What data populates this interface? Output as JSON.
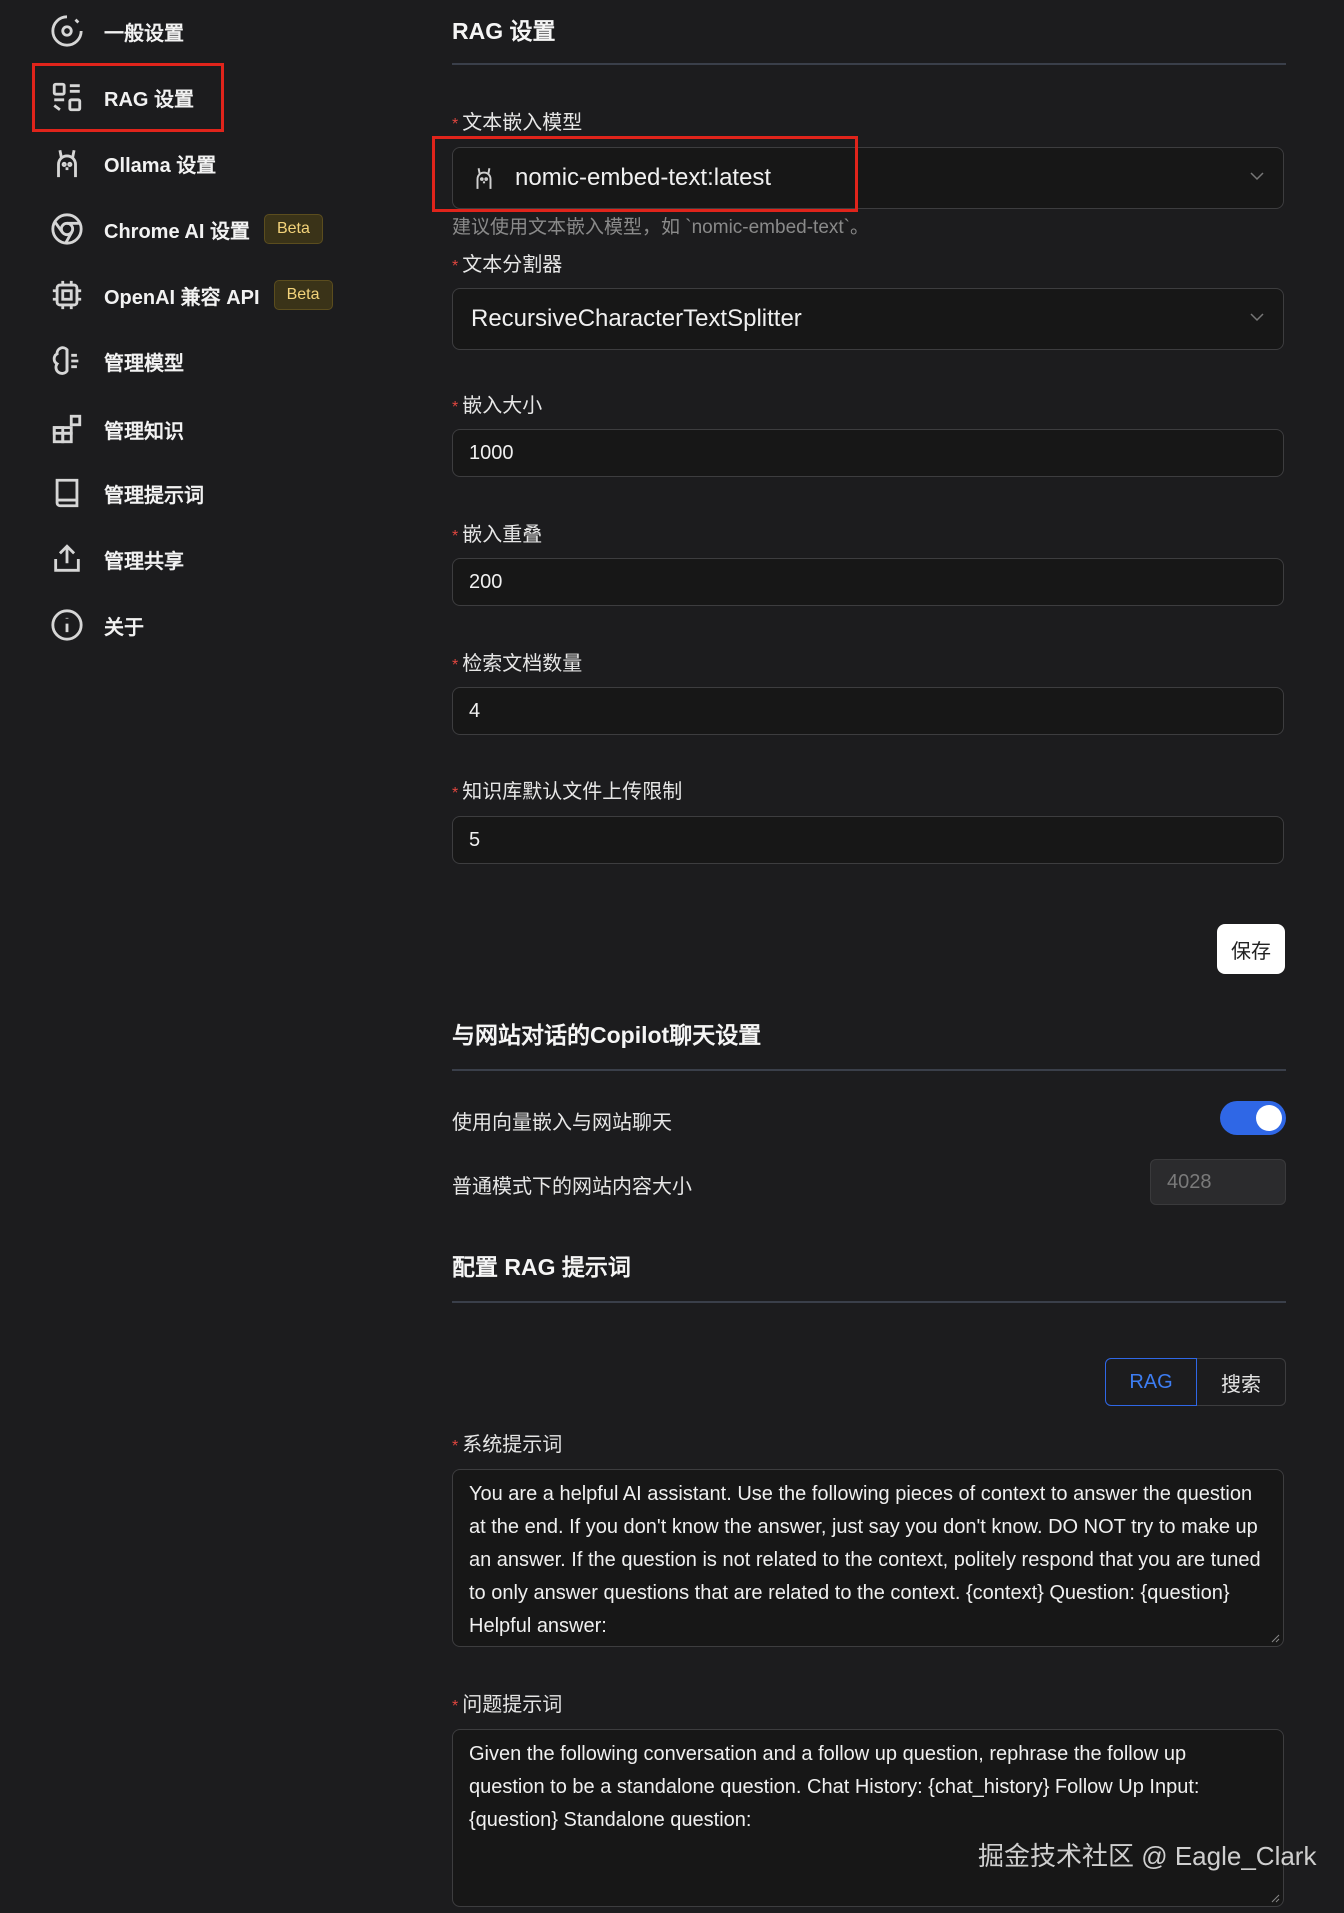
{
  "sidebar": {
    "items": [
      {
        "label": "一般设置",
        "icon": "settings-cog-icon"
      },
      {
        "label": "RAG 设置",
        "icon": "rag-blocks-icon"
      },
      {
        "label": "Ollama 设置",
        "icon": "llama-icon"
      },
      {
        "label": "Chrome AI 设置",
        "icon": "chrome-icon",
        "badge": "Beta"
      },
      {
        "label": "OpenAI 兼容 API",
        "icon": "cpu-chip-icon",
        "badge": "Beta"
      },
      {
        "label": "管理模型",
        "icon": "brain-icon"
      },
      {
        "label": "管理知识",
        "icon": "blocks-icon"
      },
      {
        "label": "管理提示词",
        "icon": "book-icon"
      },
      {
        "label": "管理共享",
        "icon": "share-upload-icon"
      },
      {
        "label": "关于",
        "icon": "info-icon"
      }
    ]
  },
  "rag": {
    "title": "RAG 设置",
    "embedding_model": {
      "label": "文本嵌入模型",
      "value": "nomic-embed-text:latest",
      "hint": "建议使用文本嵌入模型，如 `nomic-embed-text`。"
    },
    "splitter": {
      "label": "文本分割器",
      "value": "RecursiveCharacterTextSplitter"
    },
    "chunk_size": {
      "label": "嵌入大小",
      "value": "1000"
    },
    "chunk_overlap": {
      "label": "嵌入重叠",
      "value": "200"
    },
    "doc_count": {
      "label": "检索文档数量",
      "value": "4"
    },
    "upload_limit": {
      "label": "知识库默认文件上传限制",
      "value": "5"
    },
    "save_label": "保存"
  },
  "copilot": {
    "title": "与网站对话的Copilot聊天设置",
    "vector_chat_label": "使用向量嵌入与网站聊天",
    "vector_chat_enabled": true,
    "content_size_label": "普通模式下的网站内容大小",
    "content_size_placeholder": "4028"
  },
  "prompts": {
    "title": "配置 RAG 提示词",
    "tabs": {
      "rag": "RAG",
      "search": "搜索",
      "active": "RAG"
    },
    "system_label": "系统提示词",
    "system_value": "You are a helpful AI assistant. Use the following pieces of context to answer the question at the end. If you don't know the answer, just say you don't know. DO NOT try to make up an answer. If the question is not related to the context, politely respond that you are tuned to only answer questions that are related to the context.  {context}  Question: {question} Helpful answer:",
    "question_label": "问题提示词",
    "question_value": "Given the following conversation and a follow up question, rephrase the follow up question to be a standalone question.   Chat History: {chat_history} Follow Up Input: {question} Standalone question:"
  },
  "watermark": "掘金技术社区 @ Eagle_Clark",
  "colors": {
    "accent": "#2f67e6",
    "highlight": "#e0241b",
    "background": "#1c1c1e"
  }
}
